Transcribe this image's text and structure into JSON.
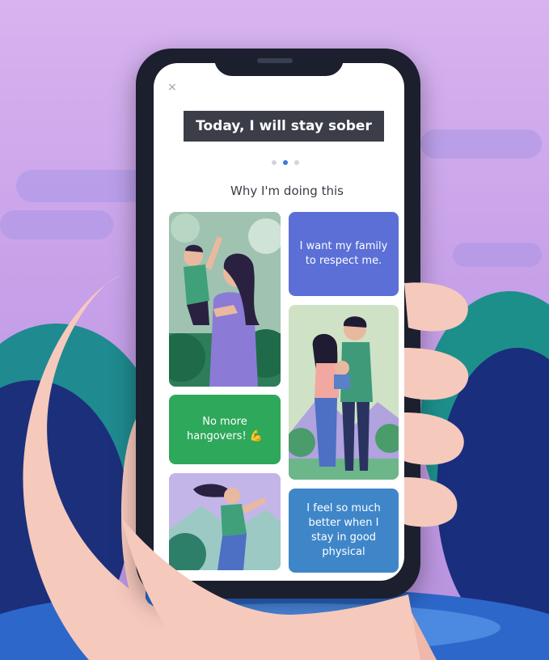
{
  "app": {
    "close_icon": "close-icon",
    "subheading": "",
    "banner_text": "Today, I will stay sober",
    "pager": {
      "count": 3,
      "active_index": 1
    },
    "section_title": "Why I'm doing this"
  },
  "cards": {
    "respect": {
      "text": "I want my family to respect me.",
      "color": "#5b6fd6"
    },
    "hangovers": {
      "text": "No more hangovers! 💪",
      "color": "#2ea85b"
    },
    "physical": {
      "text": "I feel so much better when I stay in good physical",
      "color": "#3f86c9"
    },
    "illustrations": [
      "mother-and-child-illustration",
      "family-illustration",
      "runner-illustration"
    ]
  },
  "colors": {
    "banner_bg": "#3b3d48",
    "pager_active": "#3a7bd5",
    "background": "#c9a3e6"
  }
}
